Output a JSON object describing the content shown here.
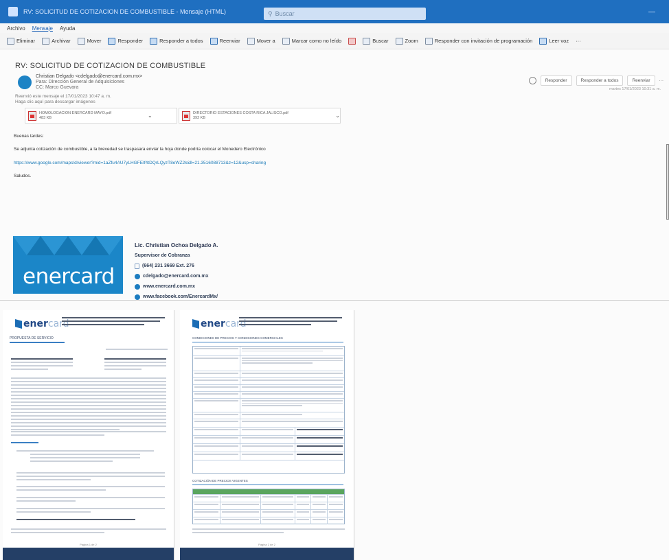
{
  "titlebar": {
    "window_title": "RV: SOLICITUD DE COTIZACION DE COMBUSTIBLE - Mensaje (HTML)",
    "search_placeholder": "Buscar"
  },
  "menu": {
    "items": [
      "Archivo",
      "Mensaje",
      "Ayuda"
    ]
  },
  "ribbon": {
    "items": [
      "Eliminar",
      "Archivar",
      "Mover",
      "Responder",
      "Responder a todos",
      "Reenviar",
      "Mover a",
      "Marcar como no leído",
      "Buscar",
      "Zoom",
      "Responder con invitación de programación",
      "Leer voz",
      "···"
    ]
  },
  "message": {
    "subject": "RV: SOLICITUD DE COTIZACION DE COMBUSTIBLE",
    "sender_name": "Christian Delgado <cdelgado@enercard.com.mx>",
    "to_line": "Para: Dirección General de Adquisiciones",
    "cc_line": "CC: Marco Guevara",
    "fwd_note_1": "Reenvió este mensaje el 17/01/2023 10:47 a. m.",
    "fwd_note_2": "Haga clic aquí para descargar imágenes",
    "actions": [
      "Responder",
      "Responder a todos",
      "Reenviar",
      "···"
    ],
    "datetime": "martes 17/01/2023 10:31 a. m.",
    "greeting": "Buenas tardes:",
    "body": "Se adjunta cotización de combustible, a la brevedad se traspasara enviar la hoja donde podría colocar el Monedero Electrónico",
    "link": "https://www.google.com/maps/d/viewer?mid=1aZfu4AU7yLHGFEIf4tDQrLQyzT8eWZ2k&ll=21.3516088713&z=12&usp=sharing",
    "closing": "Saludos."
  },
  "attachments": [
    {
      "name": "HOMOLOGACION ENERCARD MAYO.pdf",
      "size": "483 KB"
    },
    {
      "name": "DIRECTORIO ESTACIONES COSTA RICA JALISCO.pdf",
      "size": "392 KB"
    }
  ],
  "signature": {
    "brand": "enercard",
    "name": "Lic. Christian Ochoa Delgado A.",
    "role": "Supervisor de Cobranza",
    "phone": "(664) 231 3669 Ext. 276",
    "email": "cdelgado@enercard.com.mx",
    "web": "www.enercard.com.mx",
    "facebook": "www.facebook.com/EnercardMx/"
  },
  "doc_left": {
    "brand_bold": "ener",
    "brand_light": "card",
    "section_title": "PROPUESTA DE SERVICIO",
    "page": "Página 1 de 2"
  },
  "doc_right": {
    "brand_bold": "ener",
    "brand_light": "card",
    "section_title": "CONDICIONES DE PRECIOS Y CONDICIONES COMERCIALES",
    "section_title_2": "COTIZACIÓN DE PRECIOS VIGENTES",
    "page": "Página 2 de 2"
  },
  "colors": {
    "accent": "#1f6fc0",
    "brand": "#1b86c8",
    "footer": "#243f66"
  }
}
